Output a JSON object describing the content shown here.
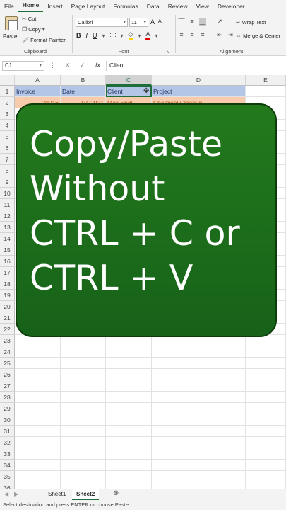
{
  "ribbon_tabs": [
    "File",
    "Home",
    "Insert",
    "Page Layout",
    "Formulas",
    "Data",
    "Review",
    "View",
    "Developer"
  ],
  "clipboard": {
    "paste_label": "Paste",
    "cut_label": "Cut",
    "copy_label": "Copy",
    "format_painter_label": "Format Painter",
    "group_label": "Clipboard"
  },
  "font": {
    "font_name": "Calibri",
    "font_size": "11",
    "bold": "B",
    "italic": "I",
    "underline": "U",
    "grow": "A",
    "shrink": "A",
    "fill_color_glyph": "◇",
    "font_color_glyph": "A",
    "group_label": "Font"
  },
  "alignment": {
    "wrap_text": "Wrap Text",
    "merge_center": "Merge & Center",
    "group_label": "Alignment"
  },
  "formula_bar": {
    "name_box": "C1",
    "fx": "fx",
    "cancel": "✕",
    "enter": "✓",
    "value": "Client"
  },
  "columns": [
    "A",
    "B",
    "C",
    "D",
    "E"
  ],
  "rows": [
    "1",
    "2",
    "3",
    "4",
    "5",
    "6",
    "7",
    "8",
    "9",
    "10",
    "11",
    "12",
    "13",
    "14",
    "15",
    "16",
    "17",
    "18",
    "19",
    "20",
    "21",
    "22",
    "23",
    "24",
    "25",
    "26",
    "27",
    "28",
    "29",
    "30",
    "31",
    "32",
    "33",
    "34",
    "35",
    "36"
  ],
  "header_row": [
    "Invoice",
    "Date",
    "Client",
    "Project"
  ],
  "row2": [
    "20016",
    "1/4/2021",
    "Max Engli",
    "Chemical Cleanup"
  ],
  "overlay": {
    "line1": "Copy/Paste",
    "line2": "Without",
    "line3": "CTRL + C or",
    "line4": "CTRL + V",
    "bg_color": "#1c6d18"
  },
  "sheet_tabs": [
    "Sheet1",
    "Sheet2"
  ],
  "add_sheet": "⊕",
  "status_text": "Select destination and press ENTER or choose Paste"
}
